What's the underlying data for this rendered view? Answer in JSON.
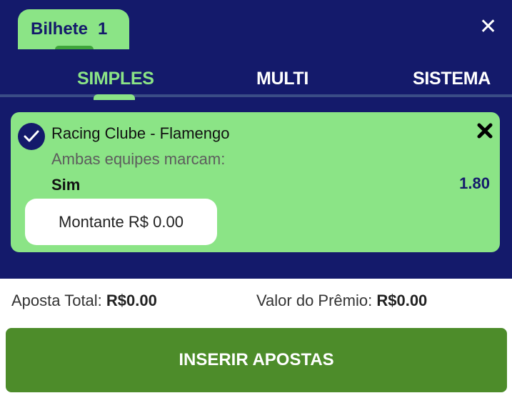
{
  "ticket": {
    "label": "Bilhete",
    "count": "1"
  },
  "tabs": [
    {
      "label": "SIMPLES",
      "active": true
    },
    {
      "label": "MULTI",
      "active": false
    },
    {
      "label": "SISTEMA",
      "active": false
    }
  ],
  "bet": {
    "match": "Racing Clube - Flamengo",
    "market": "Ambas equipes marcam:",
    "selection": "Sim",
    "odds": "1.80",
    "stake_placeholder": "Montante R$ 0.00"
  },
  "totals": {
    "total_label": "Aposta Total:",
    "total_value": "R$0.00",
    "prize_label": "Valor do Prêmio:",
    "prize_value": "R$0.00"
  },
  "submit_label": "INSERIR APOSTAS",
  "colors": {
    "navy": "#141a6b",
    "light_green": "#8be486",
    "button_green": "#4d8c2a"
  }
}
